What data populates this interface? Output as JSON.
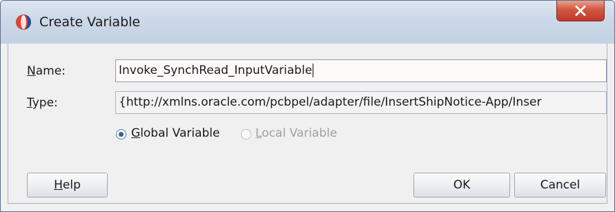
{
  "window": {
    "title": "Create Variable",
    "close_symbol": "X",
    "app_icon": "oracle-jdeveloper-icon"
  },
  "form": {
    "name_label_first": "N",
    "name_label_rest": "ame:",
    "name_value": "Invoke_SynchRead_InputVariable",
    "type_label_first": "T",
    "type_label_rest": "ype:",
    "type_value": "{http://xmlns.oracle.com/pcbpel/adapter/file/InsertShipNotice-App/Inser"
  },
  "scope": {
    "global_first": "G",
    "global_rest": "lobal Variable",
    "global_selected": true,
    "local_first": "L",
    "local_rest": "ocal Variable",
    "local_enabled": false
  },
  "buttons": {
    "help_first": "H",
    "help_rest": "elp",
    "ok": "OK",
    "cancel": "Cancel"
  },
  "colors": {
    "title_bar": "#cdd9e8",
    "close_button": "#c0392b",
    "field_border": "#8a99ad",
    "radio_selected": "#2f5f9e"
  }
}
